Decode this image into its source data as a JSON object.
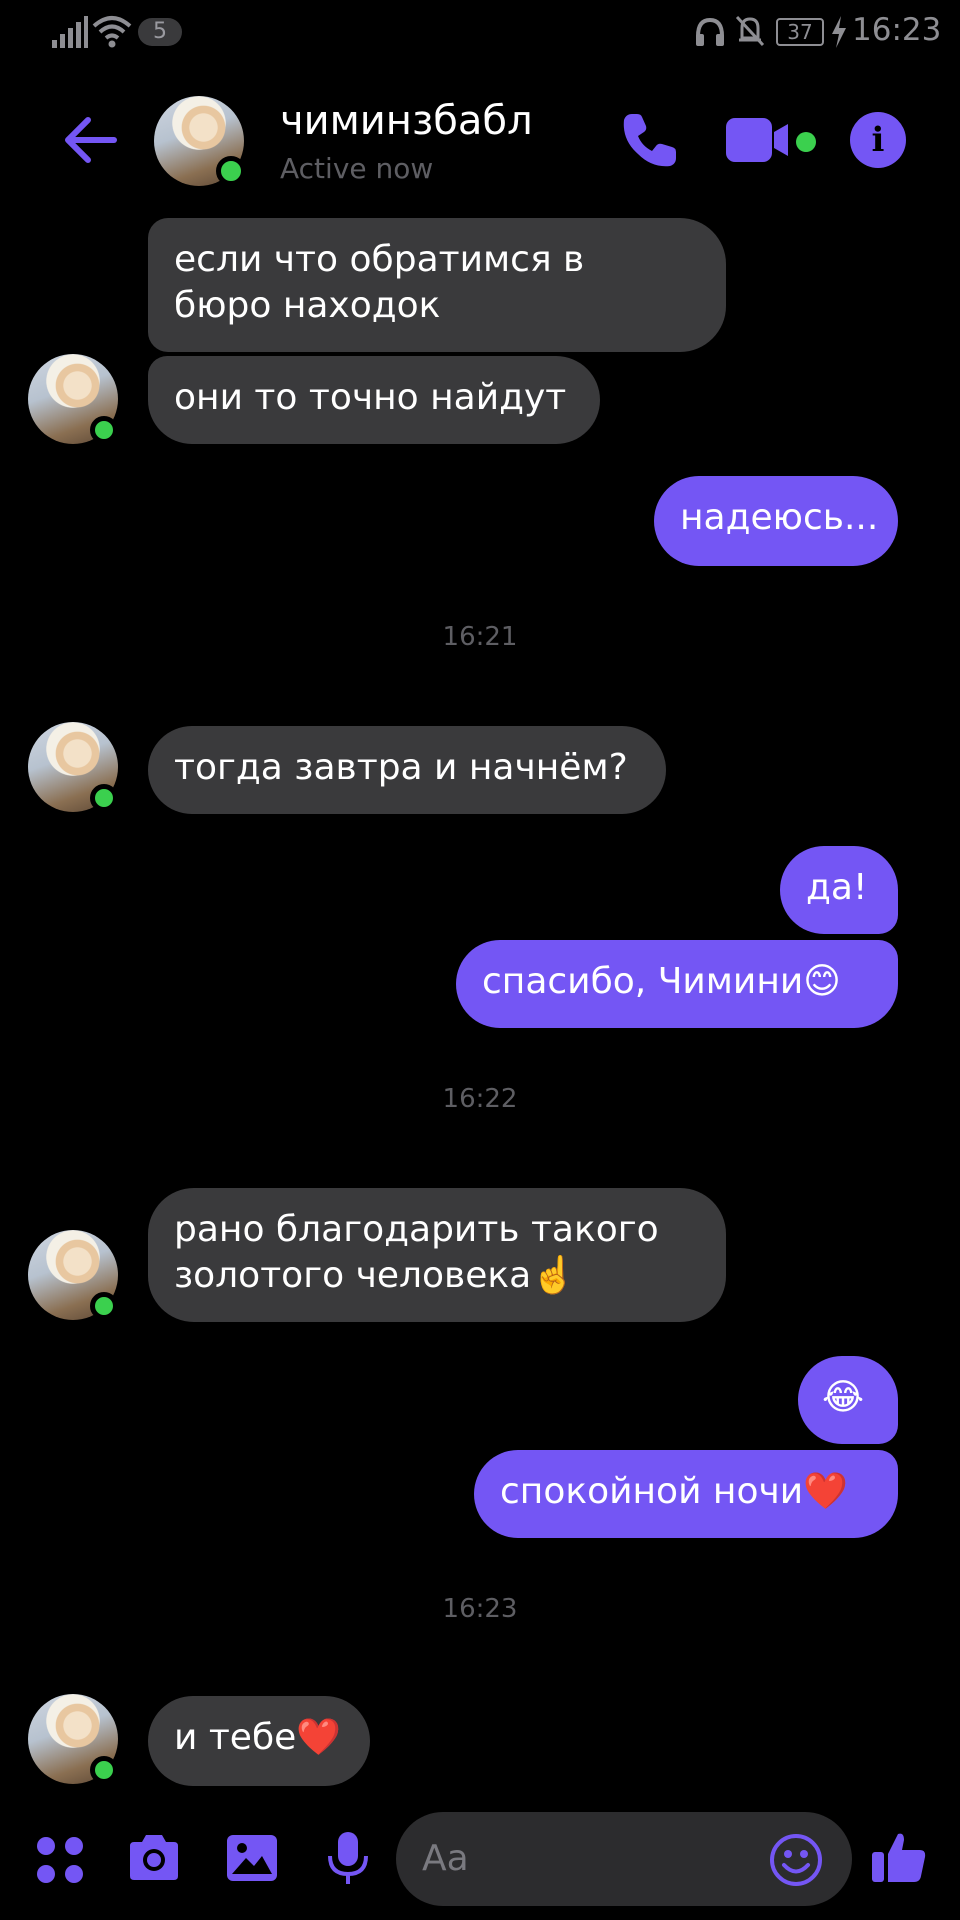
{
  "status_bar": {
    "sim_badge": "5",
    "battery": "37",
    "time": "16:23"
  },
  "header": {
    "contact_name": "чиминзбабл",
    "contact_status": "Active now"
  },
  "messages": [
    {
      "dir": "in",
      "text_lines": [
        "если что обратимся в",
        "бюро находок"
      ]
    },
    {
      "dir": "in",
      "text": "они то точно найдут"
    },
    {
      "dir": "out",
      "text": "надеюсь..."
    },
    {
      "time": "16:21"
    },
    {
      "dir": "in",
      "text": "тогда завтра и начнём?"
    },
    {
      "dir": "out",
      "text": "да!"
    },
    {
      "dir": "out",
      "text": "спасибо, Чимини😊"
    },
    {
      "time": "16:22"
    },
    {
      "dir": "in",
      "text_lines": [
        "рано благодарить такого",
        "золотого человека☝️"
      ]
    },
    {
      "dir": "out",
      "text": "😂"
    },
    {
      "dir": "out",
      "text": "спокойной ночи❤️"
    },
    {
      "time": "16:23"
    },
    {
      "dir": "in",
      "text": "и тебе❤️"
    }
  ],
  "composer": {
    "placeholder": "Aa"
  },
  "theme": {
    "accent": "#7456f4",
    "incoming_bubble": "#3a3a3c",
    "online_dot": "#3bd04e"
  },
  "icons": [
    "back-arrow-icon",
    "phone-icon",
    "video-camera-icon",
    "info-icon",
    "menu-dots-icon",
    "camera-icon",
    "gallery-icon",
    "microphone-icon",
    "emoji-icon",
    "thumbs-up-icon"
  ]
}
